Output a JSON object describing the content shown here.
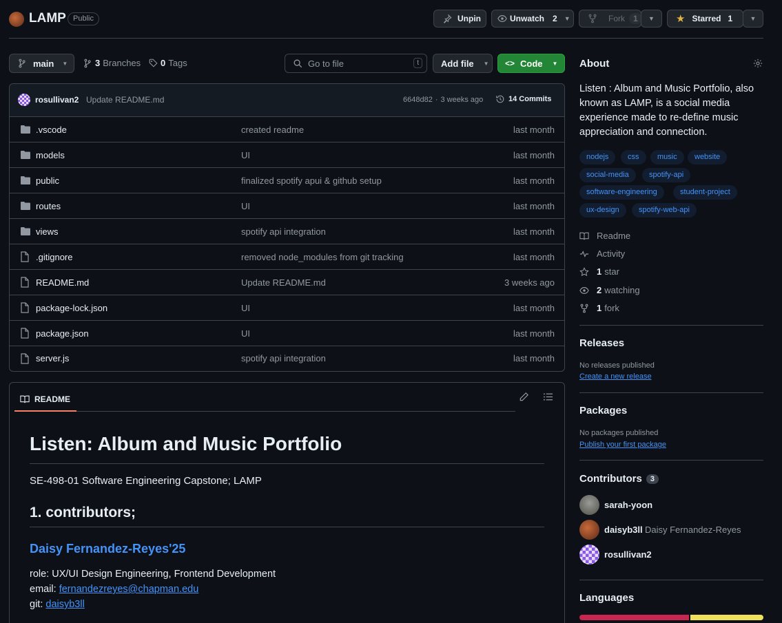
{
  "repo": {
    "name": "LAMP",
    "visibility": "Public"
  },
  "header": {
    "unpin": "Unpin",
    "unwatch": "Unwatch",
    "watch_count": "2",
    "fork": "Fork",
    "fork_count": "1",
    "starred": "Starred",
    "star_count": "1"
  },
  "toolbar": {
    "branch": "main",
    "branches_count": "3",
    "branches_label": "Branches",
    "tags_count": "0",
    "tags_label": "Tags",
    "goto_placeholder": "Go to file",
    "goto_key": "t",
    "add_file": "Add file",
    "code": "Code"
  },
  "commit": {
    "author": "rosullivan2",
    "message": "Update README.md",
    "hash": "6648d82",
    "sep": "·",
    "time": "3 weeks ago",
    "commits_label": "14 Commits"
  },
  "files": [
    {
      "name": ".vscode",
      "type": "dir",
      "message": "created readme",
      "date": "last month"
    },
    {
      "name": "models",
      "type": "dir",
      "message": "UI",
      "date": "last month"
    },
    {
      "name": "public",
      "type": "dir",
      "message": "finalized spotify apui & github setup",
      "date": "last month"
    },
    {
      "name": "routes",
      "type": "dir",
      "message": "UI",
      "date": "last month"
    },
    {
      "name": "views",
      "type": "dir",
      "message": "spotify api integration",
      "date": "last month"
    },
    {
      "name": ".gitignore",
      "type": "file",
      "message": "removed node_modules from git tracking",
      "date": "last month"
    },
    {
      "name": "README.md",
      "type": "file",
      "message": "Update README.md",
      "date": "3 weeks ago"
    },
    {
      "name": "package-lock.json",
      "type": "file",
      "message": "UI",
      "date": "last month"
    },
    {
      "name": "package.json",
      "type": "file",
      "message": "UI",
      "date": "last month"
    },
    {
      "name": "server.js",
      "type": "file",
      "message": "spotify api integration",
      "date": "last month"
    }
  ],
  "readme": {
    "tab": "README",
    "h1": "Listen: Album and Music Portfolio",
    "subtitle": "SE-498-01 Software Engineering Capstone; LAMP",
    "h2": "1. contributors;",
    "h3": "Daisy Fernandez-Reyes'25",
    "role_label": "role:",
    "role": "UX/UI Design Engineering, Frontend Development",
    "email_label": "email:",
    "email": "fernandezreyes@chapman.edu",
    "git_label": "git:",
    "git": "daisyb3ll"
  },
  "about": {
    "title": "About",
    "description": "Listen : Album and Music Portfolio, also known as LAMP, is a social media experience made to re-define music appreciation and connection.",
    "topics": [
      "nodejs",
      "css",
      "music",
      "website",
      "social-media",
      "spotify-api",
      "software-engineering",
      "student-project",
      "ux-design",
      "spotify-web-api"
    ],
    "readme": "Readme",
    "activity": "Activity",
    "stars_count": "1",
    "stars_label": "star",
    "watching_count": "2",
    "watching_label": "watching",
    "forks_count": "1",
    "forks_label": "fork"
  },
  "releases": {
    "title": "Releases",
    "none": "No releases published",
    "link": "Create a new release"
  },
  "packages": {
    "title": "Packages",
    "none": "No packages published",
    "link": "Publish your first package"
  },
  "contributors": {
    "title": "Contributors",
    "count": "3",
    "list": [
      {
        "login": "sarah-yoon",
        "name": ""
      },
      {
        "login": "daisyb3ll",
        "name": "Daisy Fernandez-Reyes"
      },
      {
        "login": "rosullivan2",
        "name": ""
      }
    ]
  },
  "languages": {
    "title": "Languages",
    "bars": [
      {
        "share": 0.6,
        "color": "#c6264f"
      },
      {
        "share": 0.4,
        "color": "#f1e05a"
      }
    ]
  },
  "colors": {
    "accent": "#4493f8",
    "green": "#238636",
    "bg": "#0d1117",
    "border": "#3d444d"
  }
}
